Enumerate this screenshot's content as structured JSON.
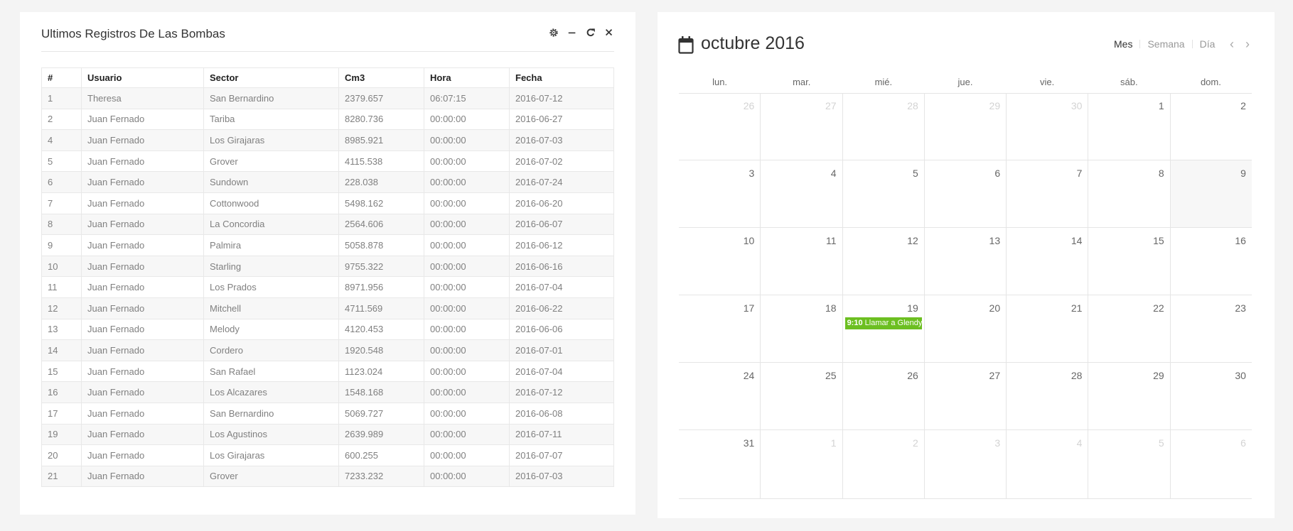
{
  "table_widget": {
    "title": "Ultimos Registros De Las Bombas",
    "tools": [
      "settings-icon",
      "minimize-icon",
      "refresh-icon",
      "close-icon"
    ],
    "columns": [
      "#",
      "Usuario",
      "Sector",
      "Cm3",
      "Hora",
      "Fecha"
    ],
    "rows": [
      [
        "1",
        "Theresa",
        "San Bernardino",
        "2379.657",
        "06:07:15",
        "2016-07-12"
      ],
      [
        "2",
        "Juan Fernado",
        "Tariba",
        "8280.736",
        "00:00:00",
        "2016-06-27"
      ],
      [
        "4",
        "Juan Fernado",
        "Los Girajaras",
        "8985.921",
        "00:00:00",
        "2016-07-03"
      ],
      [
        "5",
        "Juan Fernado",
        "Grover",
        "4115.538",
        "00:00:00",
        "2016-07-02"
      ],
      [
        "6",
        "Juan Fernado",
        "Sundown",
        "228.038",
        "00:00:00",
        "2016-07-24"
      ],
      [
        "7",
        "Juan Fernado",
        "Cottonwood",
        "5498.162",
        "00:00:00",
        "2016-06-20"
      ],
      [
        "8",
        "Juan Fernado",
        "La Concordia",
        "2564.606",
        "00:00:00",
        "2016-06-07"
      ],
      [
        "9",
        "Juan Fernado",
        "Palmira",
        "5058.878",
        "00:00:00",
        "2016-06-12"
      ],
      [
        "10",
        "Juan Fernado",
        "Starling",
        "9755.322",
        "00:00:00",
        "2016-06-16"
      ],
      [
        "11",
        "Juan Fernado",
        "Los Prados",
        "8971.956",
        "00:00:00",
        "2016-07-04"
      ],
      [
        "12",
        "Juan Fernado",
        "Mitchell",
        "4711.569",
        "00:00:00",
        "2016-06-22"
      ],
      [
        "13",
        "Juan Fernado",
        "Melody",
        "4120.453",
        "00:00:00",
        "2016-06-06"
      ],
      [
        "14",
        "Juan Fernado",
        "Cordero",
        "1920.548",
        "00:00:00",
        "2016-07-01"
      ],
      [
        "15",
        "Juan Fernado",
        "San Rafael",
        "1123.024",
        "00:00:00",
        "2016-07-04"
      ],
      [
        "16",
        "Juan Fernado",
        "Los Alcazares",
        "1548.168",
        "00:00:00",
        "2016-07-12"
      ],
      [
        "17",
        "Juan Fernado",
        "San Bernardino",
        "5069.727",
        "00:00:00",
        "2016-06-08"
      ],
      [
        "19",
        "Juan Fernado",
        "Los Agustinos",
        "2639.989",
        "00:00:00",
        "2016-07-11"
      ],
      [
        "20",
        "Juan Fernado",
        "Los Girajaras",
        "600.255",
        "00:00:00",
        "2016-07-07"
      ],
      [
        "21",
        "Juan Fernado",
        "Grover",
        "7233.232",
        "00:00:00",
        "2016-07-03"
      ]
    ]
  },
  "calendar": {
    "title": "octubre 2016",
    "title_icon": "calendar-icon",
    "views": [
      "Mes",
      "Semana",
      "Día"
    ],
    "active_view": "Mes",
    "prev": "‹",
    "next": "›",
    "weekdays": [
      "lun.",
      "mar.",
      "mié.",
      "jue.",
      "vie.",
      "sáb.",
      "dom."
    ],
    "weeks": [
      [
        {
          "d": "26",
          "other": true
        },
        {
          "d": "27",
          "other": true
        },
        {
          "d": "28",
          "other": true
        },
        {
          "d": "29",
          "other": true
        },
        {
          "d": "30",
          "other": true
        },
        {
          "d": "1"
        },
        {
          "d": "2"
        }
      ],
      [
        {
          "d": "3"
        },
        {
          "d": "4"
        },
        {
          "d": "5"
        },
        {
          "d": "6"
        },
        {
          "d": "7"
        },
        {
          "d": "8"
        },
        {
          "d": "9",
          "today": true
        }
      ],
      [
        {
          "d": "10"
        },
        {
          "d": "11"
        },
        {
          "d": "12"
        },
        {
          "d": "13"
        },
        {
          "d": "14"
        },
        {
          "d": "15"
        },
        {
          "d": "16"
        }
      ],
      [
        {
          "d": "17"
        },
        {
          "d": "18"
        },
        {
          "d": "19",
          "event": {
            "time": "9:10",
            "title": "Llamar a Glendy"
          }
        },
        {
          "d": "20"
        },
        {
          "d": "21"
        },
        {
          "d": "22"
        },
        {
          "d": "23"
        }
      ],
      [
        {
          "d": "24"
        },
        {
          "d": "25"
        },
        {
          "d": "26"
        },
        {
          "d": "27"
        },
        {
          "d": "28"
        },
        {
          "d": "29"
        },
        {
          "d": "30"
        }
      ],
      [
        {
          "d": "31"
        },
        {
          "d": "1",
          "other": true
        },
        {
          "d": "2",
          "other": true
        },
        {
          "d": "3",
          "other": true
        },
        {
          "d": "4",
          "other": true
        },
        {
          "d": "5",
          "other": true
        },
        {
          "d": "6",
          "other": true
        }
      ]
    ],
    "event_color": "#6cbf21"
  }
}
